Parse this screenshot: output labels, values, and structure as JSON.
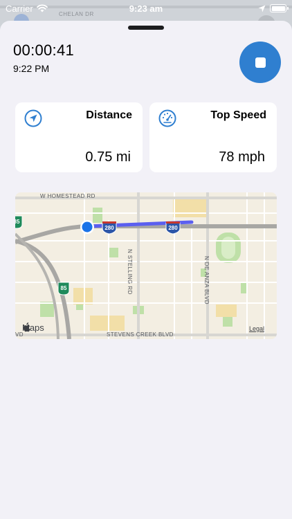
{
  "status_bar": {
    "carrier": "Carrier",
    "time": "9:23 am",
    "icons": [
      "wifi-icon",
      "location-arrow-icon",
      "battery-icon"
    ]
  },
  "background_map": {
    "street": "CHELAN DR"
  },
  "workout": {
    "elapsed": "00:00:41",
    "start_time": "9:22 PM",
    "stop_icon": "stop-icon",
    "accent_color": "#2f7fd0"
  },
  "cards": {
    "distance": {
      "title": "Distance",
      "value": "0.75 mi",
      "icon": "location-arrow-icon"
    },
    "top_speed": {
      "title": "Top Speed",
      "value": "78 mph",
      "icon": "speedometer-icon"
    }
  },
  "map": {
    "streets": {
      "homestead": "W HOMESTEAD RD",
      "stevens_creek": "STEVENS CREEK BLVD",
      "stelling": "N STELLING RD",
      "de_anza": "N DE ANZA BLVD",
      "vd": "VD"
    },
    "shields": {
      "i280_a": "280",
      "i280_b": "280",
      "sr85": "85",
      "sr85_b": "85"
    },
    "attribution": "Maps",
    "legal": "Legal",
    "route_color": "#5b5ff0",
    "location_color": "#1a73e8"
  }
}
